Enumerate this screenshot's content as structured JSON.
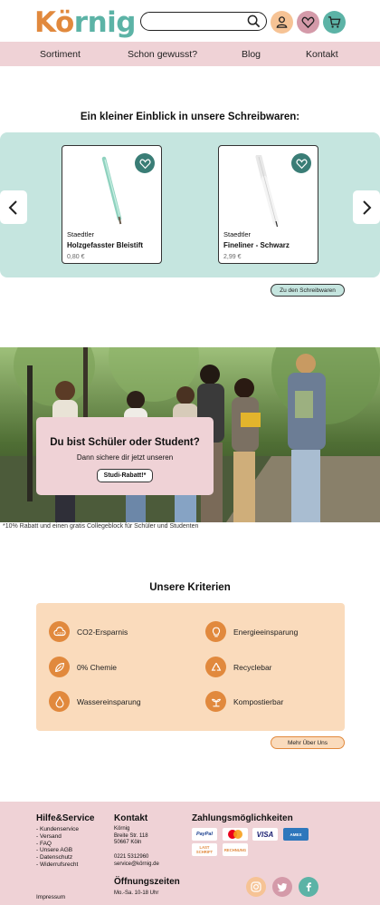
{
  "header": {
    "logo": "Körnig",
    "logo_parts": [
      "Kö",
      "rnig"
    ],
    "search_placeholder": "",
    "icons": [
      "search-icon",
      "user-icon",
      "heart-icon",
      "cart-icon"
    ]
  },
  "nav": {
    "items": [
      {
        "label": "Sortiment"
      },
      {
        "label": "Schon gewusst?"
      },
      {
        "label": "Blog"
      },
      {
        "label": "Kontakt"
      }
    ]
  },
  "products_section": {
    "title": "Ein kleiner Einblick in unsere Schreibwaren:",
    "products": [
      {
        "brand": "Staedtler",
        "name": "Holzgefasster Bleistift",
        "price": "0,80 €"
      },
      {
        "brand": "Staedtler",
        "name": "Fineliner - Schwarz",
        "price": "2,99 €"
      }
    ],
    "button": "Zu den Schreibwaren"
  },
  "hero": {
    "title": "Du bist Schüler oder Student?",
    "subtitle": "Dann sichere dir jetzt unseren",
    "button": "Studi-Rabatt!*",
    "footnote": "*10% Rabatt und einen gratis Collegeblock für Schüler und Studenten"
  },
  "kriterien": {
    "title": "Unsere Kriterien",
    "items": [
      {
        "label": "CO2-Ersparnis",
        "icon": "cloud-co2-icon"
      },
      {
        "label": "Energieeinsparung",
        "icon": "lightbulb-icon"
      },
      {
        "label": "0% Chemie",
        "icon": "leaf-icon"
      },
      {
        "label": "Recyclebar",
        "icon": "recycle-icon"
      },
      {
        "label": "Wassereinsparung",
        "icon": "water-drop-icon"
      },
      {
        "label": "Kompostierbar",
        "icon": "sprout-icon"
      }
    ],
    "button": "Mehr Über Uns"
  },
  "footer": {
    "hilfe": {
      "title": "Hilfe&Service",
      "items": [
        "Kundenservice",
        "Versand",
        "FAQ",
        "Unsere AGB",
        "Datenschutz",
        "Widerrufsrecht"
      ]
    },
    "impressum": "Impressum",
    "kontakt": {
      "title": "Kontakt",
      "address": [
        "Körnig",
        "Breite Str. 118",
        "50667 Köln"
      ],
      "phone": "0221 5312960",
      "email": "service@körnig.de"
    },
    "oeffnungszeiten": {
      "title": "Öffnungszeiten",
      "text": "Mo.-Sa. 10-18 Uhr"
    },
    "zahlung": {
      "title": "Zahlungsmöglichkeiten",
      "methods": [
        "PayPal",
        "",
        "VISA",
        "AMEX",
        "LAST SCHRIFT",
        "RECHNUNG"
      ]
    },
    "social": [
      "instagram-icon",
      "twitter-icon",
      "facebook-icon"
    ]
  },
  "colors": {
    "orange": "#e1893d",
    "teal": "#5cb3a6",
    "pink": "#efd2d6",
    "mint": "#c5e5df",
    "peach": "#fadbbc"
  }
}
